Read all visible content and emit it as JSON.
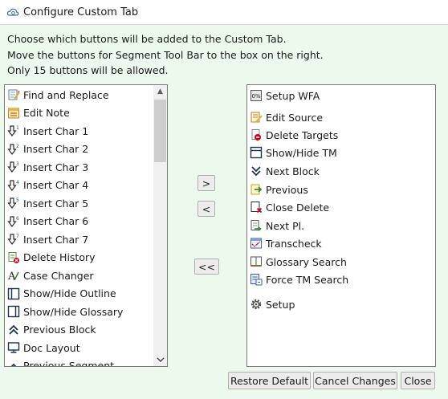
{
  "window": {
    "title": "Configure Custom Tab"
  },
  "instructions": [
    "Choose which buttons will be added to the Custom Tab.",
    "Move the buttons for Segment Tool Bar to the box on the right.",
    "Only 15 buttons will be allowed."
  ],
  "available_buttons": [
    {
      "label": "Find and Replace",
      "icon": "find-replace-icon"
    },
    {
      "label": "Edit Note",
      "icon": "note-icon"
    },
    {
      "label": "Insert Char 1",
      "icon": "insert-char-1-icon"
    },
    {
      "label": "Insert Char 2",
      "icon": "insert-char-2-icon"
    },
    {
      "label": "Insert Char 3",
      "icon": "insert-char-3-icon"
    },
    {
      "label": "Insert Char 4",
      "icon": "insert-char-4-icon"
    },
    {
      "label": "Insert Char 5",
      "icon": "insert-char-5-icon"
    },
    {
      "label": "Insert Char 6",
      "icon": "insert-char-6-icon"
    },
    {
      "label": "Insert Char 7",
      "icon": "insert-char-7-icon"
    },
    {
      "label": "Delete History",
      "icon": "delete-history-icon"
    },
    {
      "label": "Case Changer",
      "icon": "case-changer-icon"
    },
    {
      "label": "Show/Hide Outline",
      "icon": "outline-panel-icon"
    },
    {
      "label": "Show/Hide Glossary",
      "icon": "glossary-panel-icon"
    },
    {
      "label": "Previous Block",
      "icon": "double-chevron-up-icon"
    },
    {
      "label": "Doc Layout",
      "icon": "monitor-icon"
    },
    {
      "label": "Previous Segment",
      "icon": "chevron-up-icon"
    }
  ],
  "selected_buttons": [
    {
      "label": "Setup WFA",
      "icon": "wfa-icon"
    },
    {
      "label": "Edit Source",
      "icon": "edit-source-icon"
    },
    {
      "label": "Delete Targets",
      "icon": "delete-targets-icon"
    },
    {
      "label": "Show/Hide TM",
      "icon": "tm-panel-icon"
    },
    {
      "label": "Next Block",
      "icon": "double-chevron-down-icon"
    },
    {
      "label": "Previous",
      "icon": "previous-arrow-icon"
    },
    {
      "label": "Close Delete",
      "icon": "close-delete-icon"
    },
    {
      "label": "Next Pl.",
      "icon": "next-placeholder-icon"
    },
    {
      "label": "Transcheck",
      "icon": "transcheck-icon"
    },
    {
      "label": "Glossary Search",
      "icon": "glossary-book-icon"
    },
    {
      "label": "Force TM Search",
      "icon": "force-tm-icon"
    },
    {
      "label": "Setup",
      "icon": "gear-icon"
    }
  ],
  "transfer_buttons": {
    "move_right": ">",
    "move_left": "<",
    "move_all_left": "<<"
  },
  "footer": {
    "restore_default": "Restore Default",
    "cancel_changes": "Cancel Changes",
    "close": "Close"
  }
}
